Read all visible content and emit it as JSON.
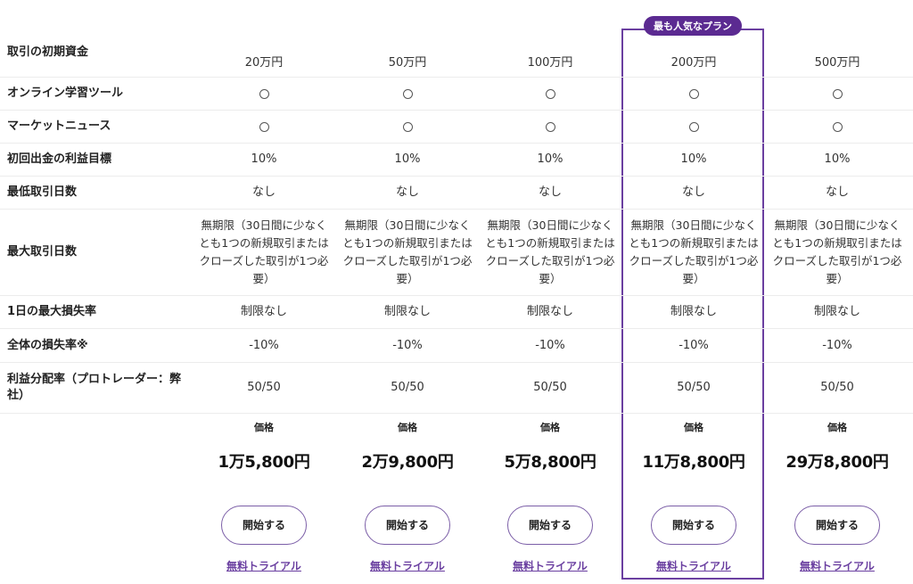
{
  "badge": "最も人気なプラン",
  "rows": {
    "capital": {
      "label": "取引の初期資金",
      "values": [
        "20万円",
        "50万円",
        "100万円",
        "200万円",
        "500万円"
      ]
    },
    "tool": {
      "label": "オンライン学習ツール"
    },
    "news": {
      "label": "マーケットニュース"
    },
    "target": {
      "label": "初回出金の利益目標",
      "values": [
        "10%",
        "10%",
        "10%",
        "10%",
        "10%"
      ]
    },
    "min_days": {
      "label": "最低取引日数",
      "values": [
        "なし",
        "なし",
        "なし",
        "なし",
        "なし"
      ]
    },
    "max_days": {
      "label": "最大取引日数",
      "values": [
        "無期限（30日間に少なくとも1つの新規取引またはクローズした取引が1つ必要）",
        "無期限（30日間に少なくとも1つの新規取引またはクローズした取引が1つ必要）",
        "無期限（30日間に少なくとも1つの新規取引またはクローズした取引が1つ必要）",
        "無期限（30日間に少なくとも1つの新規取引またはクローズした取引が1つ必要）",
        "無期限（30日間に少なくとも1つの新規取引またはクローズした取引が1つ必要）"
      ]
    },
    "daily_loss": {
      "label": "1日の最大損失率",
      "values": [
        "制限なし",
        "制限なし",
        "制限なし",
        "制限なし",
        "制限なし"
      ]
    },
    "total_loss": {
      "label": "全体の損失率※",
      "values": [
        "-10%",
        "-10%",
        "-10%",
        "-10%",
        "-10%"
      ]
    },
    "split": {
      "label": "利益分配率（プロトレーダー：弊社）",
      "values": [
        "50/50",
        "50/50",
        "50/50",
        "50/50",
        "50/50"
      ]
    }
  },
  "pricing": {
    "price_label": "価格",
    "prices": [
      "1万5,800円",
      "2万9,800円",
      "5万8,800円",
      "11万8,800円",
      "29万8,800円"
    ],
    "start_label": "開始する",
    "trial_label": "無料トライアル"
  },
  "highlight_column": 4,
  "colors": {
    "accent": "#6b3fa0",
    "badge_bg": "#5b2a91",
    "trial_link": "#6a3fa0"
  }
}
